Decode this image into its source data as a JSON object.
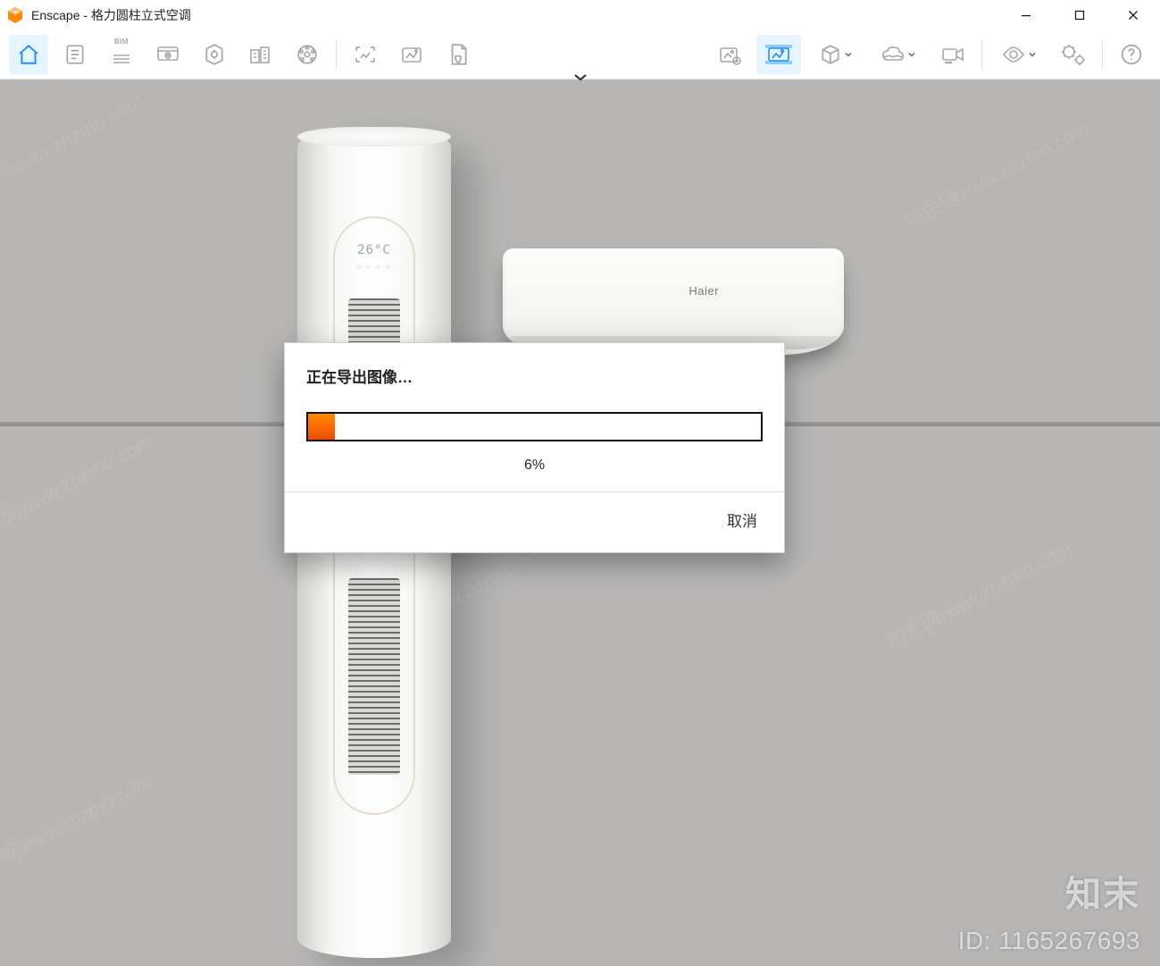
{
  "window": {
    "app_name": "Enscape",
    "title_separator": " - ",
    "document_title": "格力圆柱立式空调"
  },
  "toolbar": {
    "bim_label": "BIM"
  },
  "scene": {
    "tower_temp": "26°C",
    "tower_dots": "○ ○ ○ ○",
    "wall_brand": "Haier"
  },
  "dialog": {
    "title": "正在导出图像…",
    "progress_percent": 6,
    "progress_percent_label": "6%",
    "cancel_label": "取消"
  },
  "watermark": {
    "logo_text": "知末",
    "id_label": "ID: 1165267693",
    "diag_text": "知末网www.znzmo.com"
  }
}
